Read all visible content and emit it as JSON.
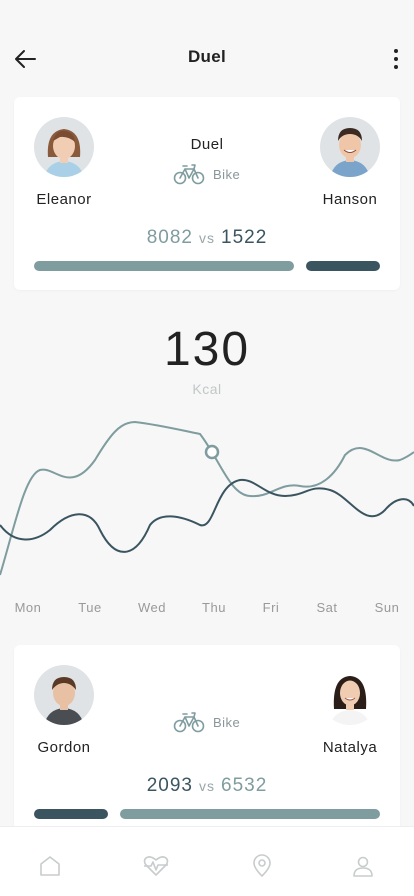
{
  "header": {
    "title": "Duel",
    "back_icon": "arrow-left-icon",
    "menu_icon": "more-vertical-icon"
  },
  "top_duel": {
    "label": "Duel",
    "mode_icon": "bicycle-icon",
    "mode": "Bike",
    "left_player": {
      "name": "Eleanor",
      "score": "8082"
    },
    "right_player": {
      "name": "Hanson",
      "score": "1522"
    },
    "vs": "vs"
  },
  "calories": {
    "value": "130",
    "unit": "Kcal"
  },
  "chart": {
    "days": [
      "Mon",
      "Tue",
      "Wed",
      "Thu",
      "Fri",
      "Sat",
      "Sun"
    ]
  },
  "bottom_duel": {
    "mode_icon": "bicycle-icon",
    "mode": "Bike",
    "left_player": {
      "name": "Gordon",
      "score": "2093"
    },
    "right_player": {
      "name": "Natalya",
      "score": "6532"
    },
    "vs": "vs"
  },
  "tabbar": {
    "tabs": [
      "home-icon",
      "heart-pulse-icon",
      "location-pin-icon",
      "profile-icon"
    ]
  },
  "colors": {
    "light_series": "#7f9c9f",
    "dark_series": "#3b5560",
    "background": "#f7f7f7"
  }
}
